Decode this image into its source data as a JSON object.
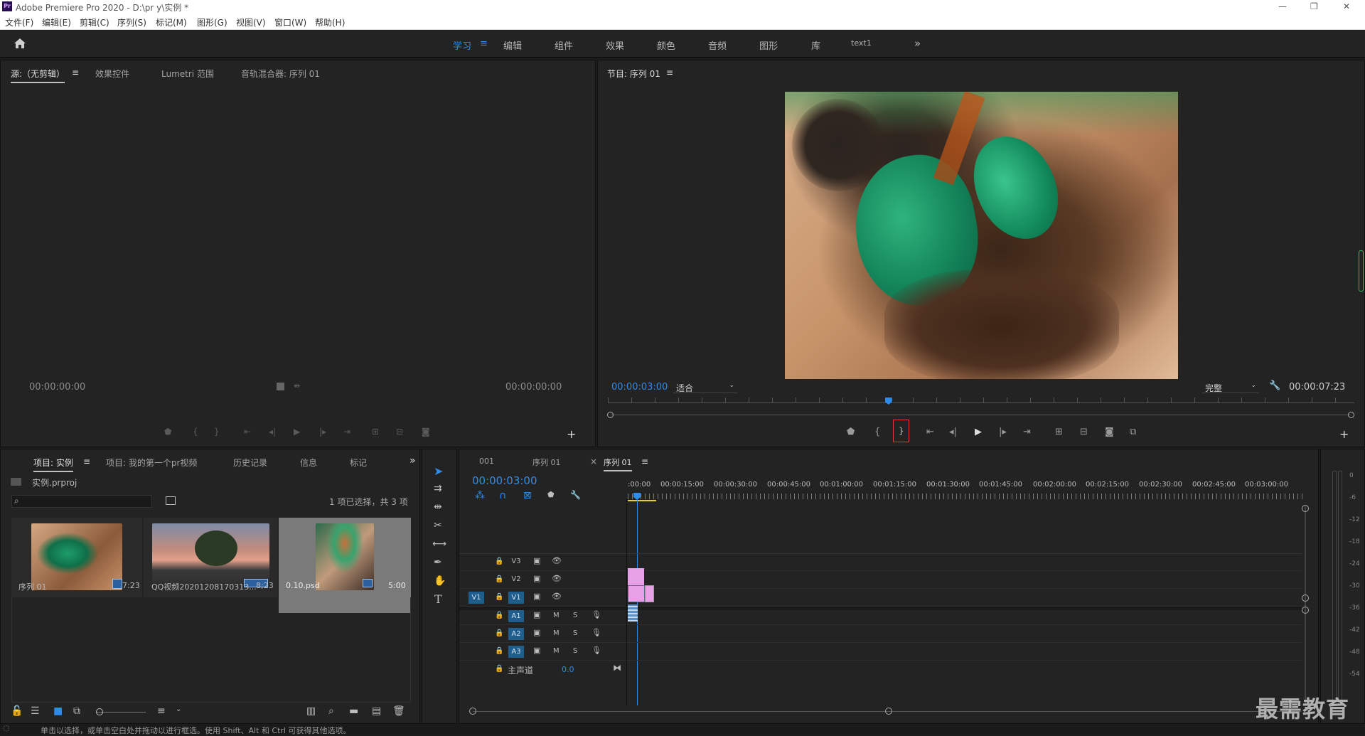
{
  "app": {
    "title": "Adobe Premiere Pro 2020 - D:\\pr y\\实例 *",
    "logo": "Pr"
  },
  "window_controls": [
    "—",
    "❐",
    "✕"
  ],
  "menu": [
    "文件(F)",
    "编辑(E)",
    "剪辑(C)",
    "序列(S)",
    "标记(M)",
    "图形(G)",
    "视图(V)",
    "窗口(W)",
    "帮助(H)"
  ],
  "workspaces": [
    "学习",
    "编辑",
    "组件",
    "效果",
    "颜色",
    "音频",
    "图形",
    "库",
    "text1"
  ],
  "workspace_menu_icon": "≡",
  "workspace_more": "»",
  "source": {
    "tabs": [
      "源:（无剪辑）",
      "效果控件",
      "Lumetri 范围",
      "音轨混合器: 序列 01"
    ],
    "menu_icon": "≡",
    "tc_left": "00:00:00:00",
    "tc_right": "00:00:00:00"
  },
  "program": {
    "tab": "节目: 序列 01",
    "menu_icon": "≡",
    "timecode": "00:00:03:00",
    "fit": "适合",
    "quality": "完整",
    "duration": "00:00:07:23",
    "playhead_position": 0.376
  },
  "project": {
    "tabs": [
      "项目: 实例",
      "项目: 我的第一个pr视频",
      "历史记录",
      "信息",
      "标记"
    ],
    "menu_icon": "≡",
    "more": "»",
    "file": "实例.prproj",
    "selection": "1 项已选择，共 3 项",
    "items": [
      {
        "name": "序列 01",
        "duration": "7:23"
      },
      {
        "name": "QQ视频20201208170313...",
        "duration": "8;23"
      },
      {
        "name": "0.10.psd",
        "duration": "5:00"
      }
    ]
  },
  "timeline": {
    "tabs": [
      "001",
      "序列 01",
      "序列 01"
    ],
    "close": "×",
    "menu_icon": "≡",
    "timecode": "00:00:03:00",
    "ruler": [
      ":00:00",
      "00:00:15:00",
      "00:00:30:00",
      "00:00:45:00",
      "00:01:00:00",
      "00:01:15:00",
      "00:01:30:00",
      "00:01:45:00",
      "00:02:00:00",
      "00:02:15:00",
      "00:02:30:00",
      "00:02:45:00",
      "00:03:00:00"
    ],
    "video_tracks": [
      "V3",
      "V2",
      "V1"
    ],
    "audio_tracks": [
      "A1",
      "A2",
      "A3"
    ],
    "source_patch": "V1",
    "master": {
      "label": "主声道",
      "value": "0.0"
    },
    "track_buttons": {
      "mute": "M",
      "solo": "S"
    }
  },
  "meter": [
    "0",
    "-6",
    "-12",
    "-18",
    "-24",
    "-30",
    "-36",
    "-42",
    "-48",
    "-54"
  ],
  "status": "单击以选择，或单击空白处并拖动以进行框选。使用 Shift、Alt 和 Ctrl 可获得其他选项。",
  "watermark": "最需教育",
  "colors": {
    "accent": "#2d8ceb",
    "clip_pink": "#e8a0e6",
    "audio_clip": "#5d8fc7",
    "panel": "#232323"
  }
}
